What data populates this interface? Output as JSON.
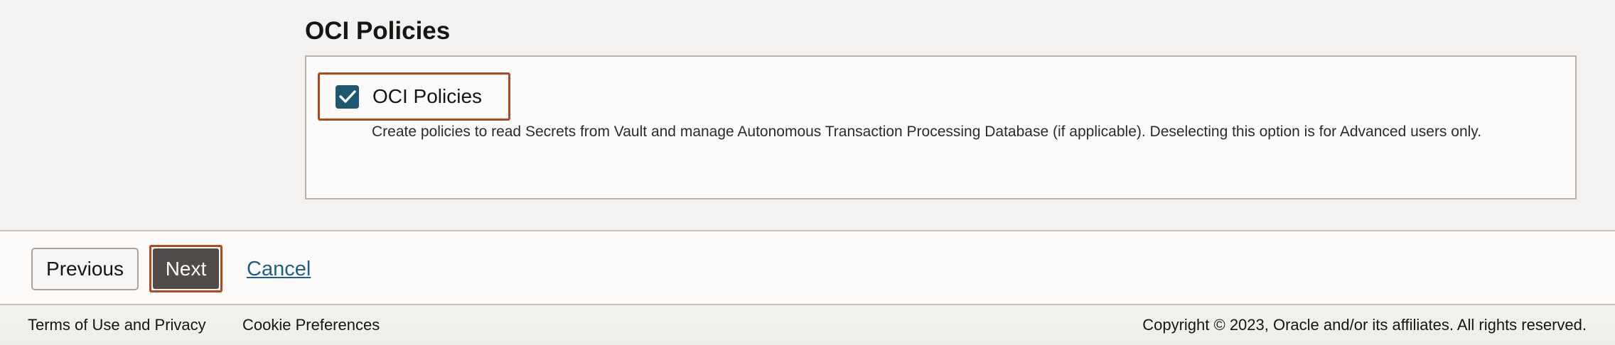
{
  "section": {
    "title": "OCI Policies",
    "option": {
      "checked": true,
      "label": "OCI Policies",
      "description": "Create policies to read Secrets from Vault and manage Autonomous Transaction Processing Database (if applicable). Deselecting this option is for Advanced users only."
    }
  },
  "navigation": {
    "previous_label": "Previous",
    "next_label": "Next",
    "cancel_label": "Cancel"
  },
  "footer": {
    "terms_label": "Terms of Use and Privacy",
    "cookies_label": "Cookie Preferences",
    "copyright": "Copyright © 2023, Oracle and/or its affiliates. All rights reserved."
  },
  "colors": {
    "highlight_border": "#b3471e",
    "checkbox_fill": "#1e5870",
    "primary_button": "#514c47",
    "link": "#1e5f86",
    "page_background": "#f4f2f0"
  },
  "icons": {
    "checkbox": "checkmark-icon"
  }
}
